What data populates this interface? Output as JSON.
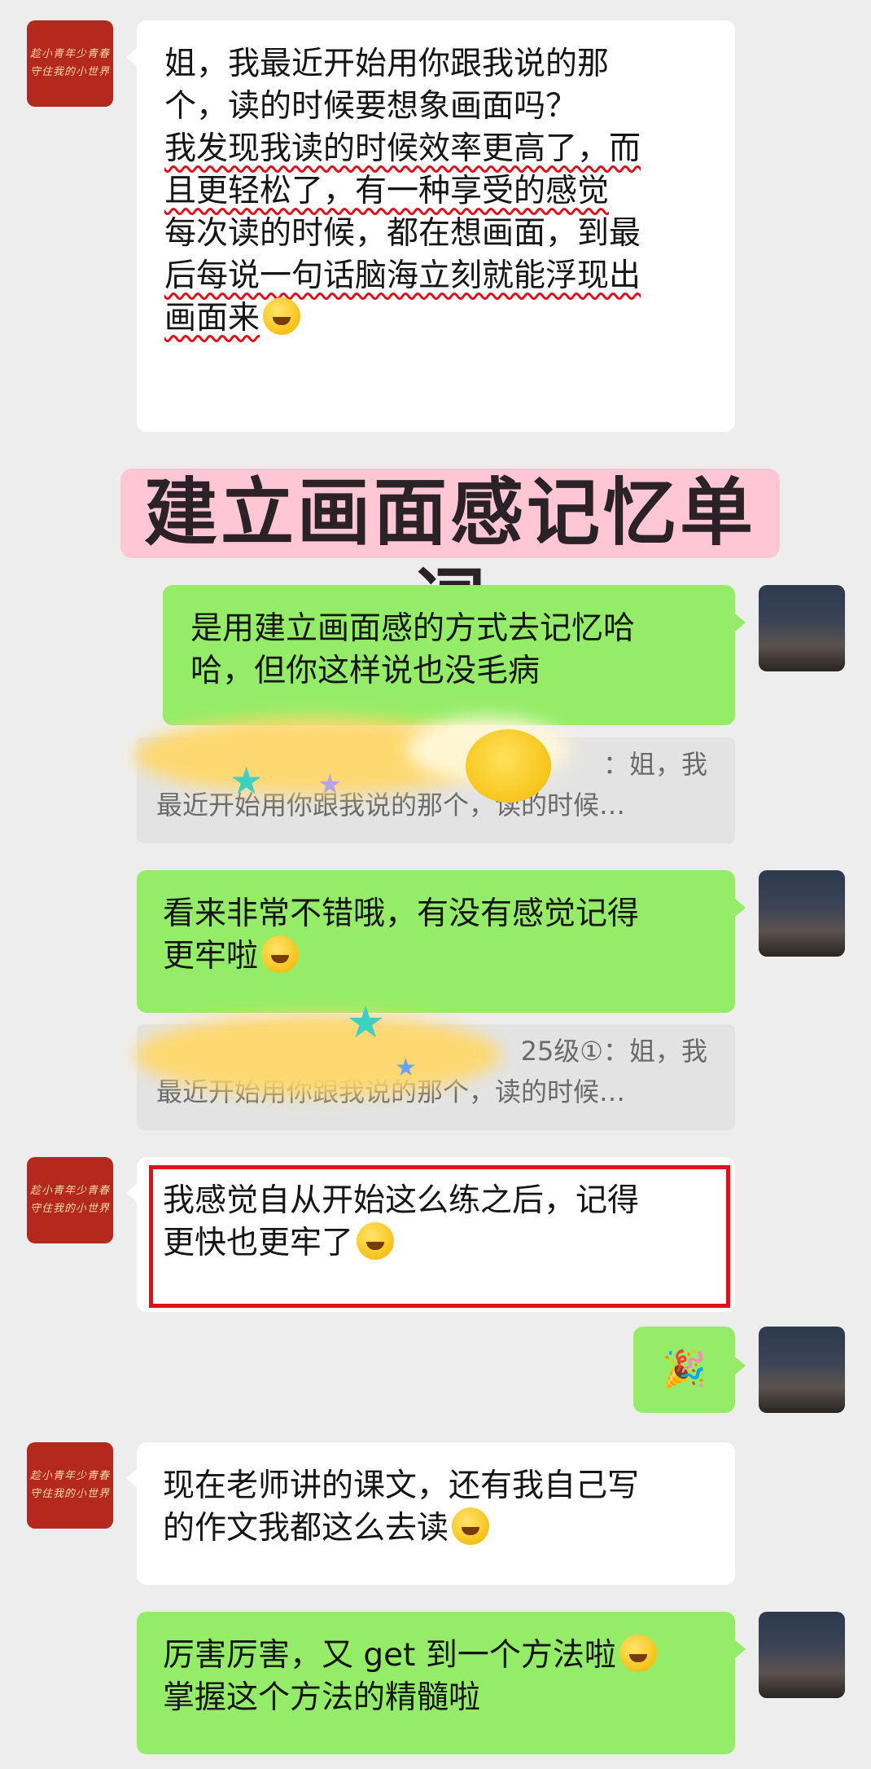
{
  "messages": {
    "m1": {
      "line1": "姐，我最近开始用你跟我说的那",
      "line2": "个，读的时候要想象画面吗？",
      "line3": "我发现我读的时候效率更高了，而",
      "line4": "且更轻松了，有一种享受的感觉",
      "line5": "每次读的时候，都在想画面，到最",
      "line6": "后每说一句话脑海立刻就能浮现出",
      "line7": "画面来"
    },
    "heading": "建立画面感记忆单词",
    "m2": {
      "line1": "是用建立画面感的方式去记忆哈",
      "line2": "哈，但你这样说也没毛病"
    },
    "q1": {
      "line1": "：姐，我",
      "line2": "最近开始用你跟我说的那个，读的时候…"
    },
    "m3": {
      "line1": "看来非常不错哦，有没有感觉记得",
      "line2": "更牢啦"
    },
    "q2": {
      "line1": "25级①：姐，我",
      "line2": "最近开始用你跟我说的那个，读的时候…"
    },
    "m4": {
      "line1": "我感觉自从开始这么练之后，记得",
      "line2": "更快也更牢了"
    },
    "m5": {
      "emoji": "🎉"
    },
    "m6": {
      "line1": "现在老师讲的课文，还有我自己写",
      "line2": "的作文我都这么去读"
    },
    "m7": {
      "line1": "厉害厉害，又 get 到一个方法啦",
      "line2": "掌握这个方法的精髓啦"
    }
  },
  "avatar_left": {
    "text1": "趁小青年少青春",
    "text2": "守住我的小世界"
  },
  "colors": {
    "background": "#ededed",
    "green_bubble": "#95ec69",
    "white_bubble": "#ffffff",
    "highlight_box": "#e0101a",
    "heading_bg": "#ffc7d6"
  }
}
